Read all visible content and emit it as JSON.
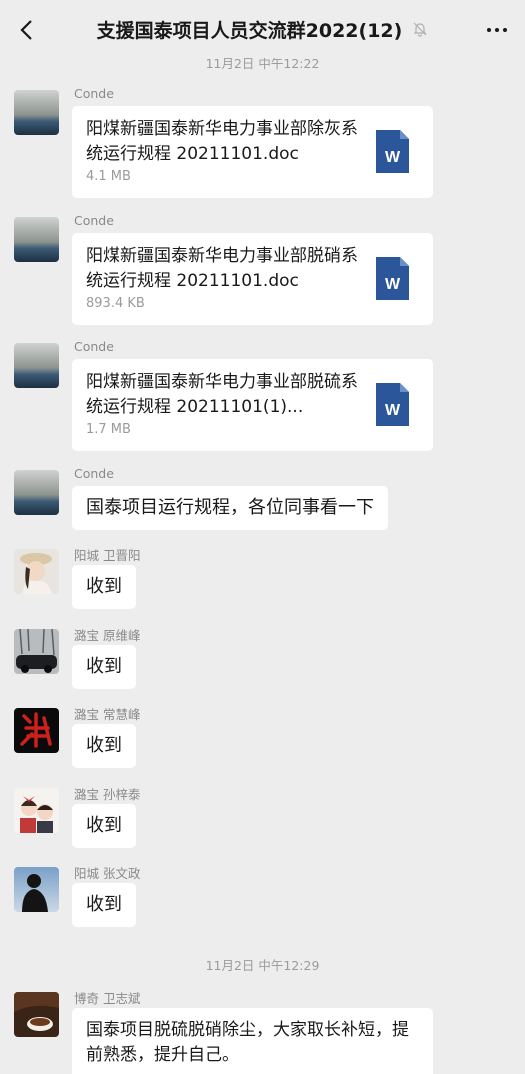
{
  "header": {
    "title": "支援国泰项目人员交流群2022(12)"
  },
  "colors": {
    "background": "#ededed",
    "bubble": "#ffffff",
    "word_blue": "#2b579a"
  },
  "timestamps": [
    "11月2日 中午12:22",
    "11月2日 中午12:29"
  ],
  "messages": [
    {
      "sender": "Conde",
      "type": "file",
      "file_name": "阳煤新疆国泰新华电力事业部除灰系统运行规程 20211101.doc",
      "file_size": "4.1 MB"
    },
    {
      "sender": "Conde",
      "type": "file",
      "file_name": "阳煤新疆国泰新华电力事业部脱硝系统运行规程 20211101.doc",
      "file_size": "893.4 KB"
    },
    {
      "sender": "Conde",
      "type": "file",
      "file_name": "阳煤新疆国泰新华电力事业部脱硫系统运行规程 20211101(1)...",
      "file_size": "1.7 MB"
    },
    {
      "sender": "Conde",
      "type": "text",
      "text": "国泰项目运行规程，各位同事看一下"
    },
    {
      "sender": "阳城 卫晋阳",
      "type": "text",
      "text": "收到"
    },
    {
      "sender": "潞宝 原维峰",
      "type": "text",
      "text": "收到"
    },
    {
      "sender": "潞宝 常慧峰",
      "type": "text",
      "text": "收到"
    },
    {
      "sender": "潞宝 孙梓泰",
      "type": "text",
      "text": "收到"
    },
    {
      "sender": "阳城 张文政",
      "type": "text",
      "text": "收到"
    },
    {
      "sender": "博奇 卫志斌",
      "type": "text",
      "text": "国泰项目脱硫脱硝除尘，大家取长补短，提前熟悉，提升自己。"
    }
  ],
  "icons": {
    "back": "chevron-left-icon",
    "mute": "bell-off-icon",
    "more": "more-dots-icon",
    "file": "word-doc-icon"
  },
  "file_icon_letter": "W"
}
